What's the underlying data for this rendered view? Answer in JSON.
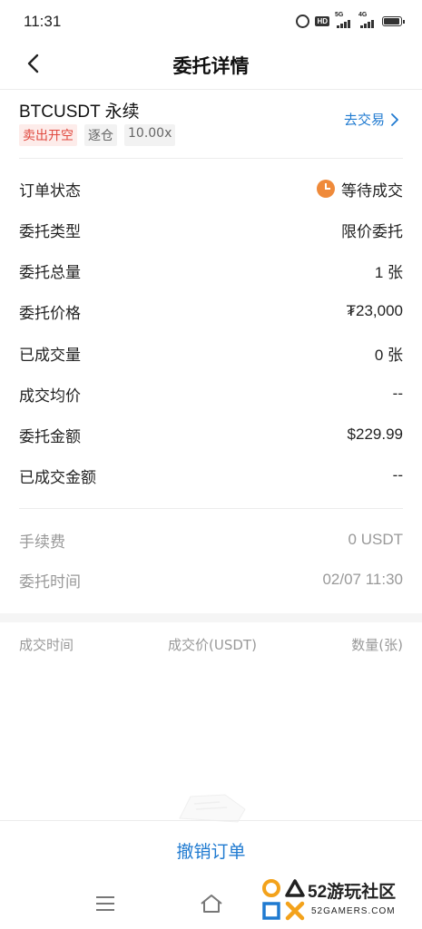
{
  "status_bar": {
    "time": "11:31",
    "hd_badge": "HD",
    "sim1_label": "5G",
    "sim2_label": "4G",
    "battery_level": 0.95
  },
  "header": {
    "title": "委托详情",
    "back_icon": "chevron-left-icon"
  },
  "order": {
    "symbol": "BTCUSDT 永续",
    "side_tag": "卖出开空",
    "margin_tag": "逐仓",
    "leverage_tag": "10.00x",
    "go_trade_label": "去交易",
    "go_trade_icon": "chevron-right-icon"
  },
  "details": {
    "status_label": "订单状态",
    "status_value": "等待成交",
    "status_icon": "clock-icon",
    "type_label": "委托类型",
    "type_value": "限价委托",
    "total_qty_label": "委托总量",
    "total_qty_value": "1 张",
    "price_label": "委托价格",
    "price_value": "₮23,000",
    "filled_qty_label": "已成交量",
    "filled_qty_value": "0 张",
    "avg_price_label": "成交均价",
    "avg_price_value": "--",
    "amount_label": "委托金额",
    "amount_value": "$229.99",
    "filled_amount_label": "已成交金额",
    "filled_amount_value": "--"
  },
  "meta": {
    "fee_label": "手续费",
    "fee_value": "0 USDT",
    "time_label": "委托时间",
    "time_value": "02/07 11:30"
  },
  "trades_table": {
    "columns": [
      "成交时间",
      "成交价(USDT)",
      "数量(张)"
    ]
  },
  "actions": {
    "cancel_label": "撤销订单"
  },
  "watermark": {
    "text": "52游玩社区",
    "sub": "52GAMERS.COM"
  },
  "colors": {
    "accent": "#1f7ad0",
    "sell": "#e0493f",
    "pending": "#ef8a3a"
  }
}
